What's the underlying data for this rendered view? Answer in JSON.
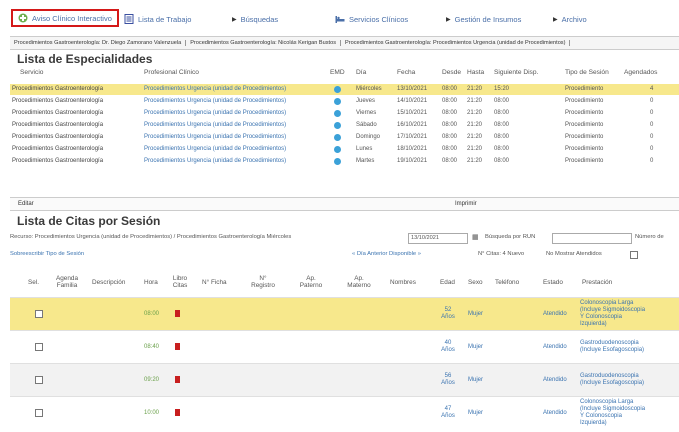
{
  "nav": {
    "items": [
      {
        "label": "Aviso Clínico Interactivo",
        "icon": "clinic-icon"
      },
      {
        "label": "Lista de Trabajo",
        "icon": "list-icon"
      },
      {
        "label": "Búsquedas",
        "icon": "arrow-right-icon"
      },
      {
        "label": "Servicios Clínicos",
        "icon": "bed-icon"
      },
      {
        "label": "Gestión de Insumos",
        "icon": "arrow-right-icon"
      },
      {
        "label": "Archivo",
        "icon": "arrow-right-icon"
      }
    ]
  },
  "breadcrumbs": [
    "Procedimientos Gastroenterología: Dr. Diego Zamorano Valenzuela",
    "Procedimientos Gastroenterología: Nicolás Kerigan Bustos",
    "Procedimientos Gastroenterología: Procedimientos Urgencia (unidad de Procedimientos)"
  ],
  "specialties": {
    "title": "Lista de Especialidades",
    "columns": [
      "Servicio",
      "Profesional Clínico",
      "EMD",
      "Día",
      "Fecha",
      "Desde",
      "Hasta",
      "Siguiente Disp.",
      "Tipo de Sesión",
      "Agendados"
    ],
    "rows": [
      {
        "servicio": "Procedimientos Gastroenterología",
        "profesional": "Procedimientos Urgencia (unidad de Procedimientos)",
        "dia": "Miércoles",
        "fecha": "13/10/2021",
        "desde": "08:00",
        "hasta": "21:20",
        "siguiente": "15:20",
        "tipo": "Procedimiento",
        "agendados": "4"
      },
      {
        "servicio": "Procedimientos Gastroenterología",
        "profesional": "Procedimientos Urgencia (unidad de Procedimientos)",
        "dia": "Jueves",
        "fecha": "14/10/2021",
        "desde": "08:00",
        "hasta": "21:20",
        "siguiente": "08:00",
        "tipo": "Procedimiento",
        "agendados": "0"
      },
      {
        "servicio": "Procedimientos Gastroenterología",
        "profesional": "Procedimientos Urgencia (unidad de Procedimientos)",
        "dia": "Viernes",
        "fecha": "15/10/2021",
        "desde": "08:00",
        "hasta": "21:20",
        "siguiente": "08:00",
        "tipo": "Procedimiento",
        "agendados": "0"
      },
      {
        "servicio": "Procedimientos Gastroenterología",
        "profesional": "Procedimientos Urgencia (unidad de Procedimientos)",
        "dia": "Sábado",
        "fecha": "16/10/2021",
        "desde": "08:00",
        "hasta": "21:20",
        "siguiente": "08:00",
        "tipo": "Procedimiento",
        "agendados": "0"
      },
      {
        "servicio": "Procedimientos Gastroenterología",
        "profesional": "Procedimientos Urgencia (unidad de Procedimientos)",
        "dia": "Domingo",
        "fecha": "17/10/2021",
        "desde": "08:00",
        "hasta": "21:20",
        "siguiente": "08:00",
        "tipo": "Procedimiento",
        "agendados": "0"
      },
      {
        "servicio": "Procedimientos Gastroenterología",
        "profesional": "Procedimientos Urgencia (unidad de Procedimientos)",
        "dia": "Lunes",
        "fecha": "18/10/2021",
        "desde": "08:00",
        "hasta": "21:20",
        "siguiente": "08:00",
        "tipo": "Procedimiento",
        "agendados": "0"
      },
      {
        "servicio": "Procedimientos Gastroenterología",
        "profesional": "Procedimientos Urgencia (unidad de Procedimientos)",
        "dia": "Martes",
        "fecha": "19/10/2021",
        "desde": "08:00",
        "hasta": "21:20",
        "siguiente": "08:00",
        "tipo": "Procedimiento",
        "agendados": "0"
      }
    ]
  },
  "editbar": {
    "edit": "Editar",
    "print": "Imprimir"
  },
  "citas": {
    "title": "Lista de Citas por Sesión",
    "resource_label": "Recurso: Procedimientos Urgencia (unidad de Procedimientos) / Procedimientos Gastroenterología Miércoles",
    "date_value": "13/10/2021",
    "search_label": "Búsqueda por RUN",
    "search_value": "",
    "number_label": "Número de",
    "overwrite_link": "Sobreescribir Tipo de Sesión",
    "nav_link": "« Día Anterior Disponible »",
    "citas_count": "N° Citas: 4 Nuevo",
    "hide_label": "No Mostrar Atendidos",
    "columns": [
      "Sel.",
      "Agenda Familia",
      "Descripción",
      "Hora",
      "Libro Citas",
      "N° Ficha",
      "N° Registro",
      "Ap. Paterno",
      "Ap. Materno",
      "Nombres",
      "Edad",
      "Sexo",
      "Teléfono",
      "Estado",
      "Prestación"
    ],
    "rows": [
      {
        "hora": "08:00",
        "edad_n": "52",
        "edad_u": "Años",
        "sexo": "Mujer",
        "estado": "Atendido",
        "prestacion": [
          "Colonoscopia Larga",
          "(Incluye Sigmoidoscopia",
          "Y Colonoscopia",
          "Izquierda)"
        ]
      },
      {
        "hora": "08:40",
        "edad_n": "40",
        "edad_u": "Años",
        "sexo": "Mujer",
        "estado": "Atendido",
        "prestacion": [
          "Gastroduodenoscopia",
          "(Incluye Esofagoscopia)"
        ]
      },
      {
        "hora": "09:20",
        "edad_n": "56",
        "edad_u": "Años",
        "sexo": "Mujer",
        "estado": "Atendido",
        "prestacion": [
          "Gastroduodenoscopia",
          "(Incluye Esofagoscopia)"
        ]
      },
      {
        "hora": "10:00",
        "edad_n": "47",
        "edad_u": "Años",
        "sexo": "Mujer",
        "estado": "Atendido",
        "prestacion": [
          "Colonoscopia Larga",
          "(Incluye Sigmoidoscopia",
          "Y Colonoscopia",
          "Izquierda)"
        ]
      }
    ]
  },
  "colors": {
    "highlight": "#f7e88c",
    "link": "#3a73b0",
    "active_border": "#d41818",
    "emd_dot": "#3ba1d8",
    "book_flag": "#c81f1f"
  }
}
